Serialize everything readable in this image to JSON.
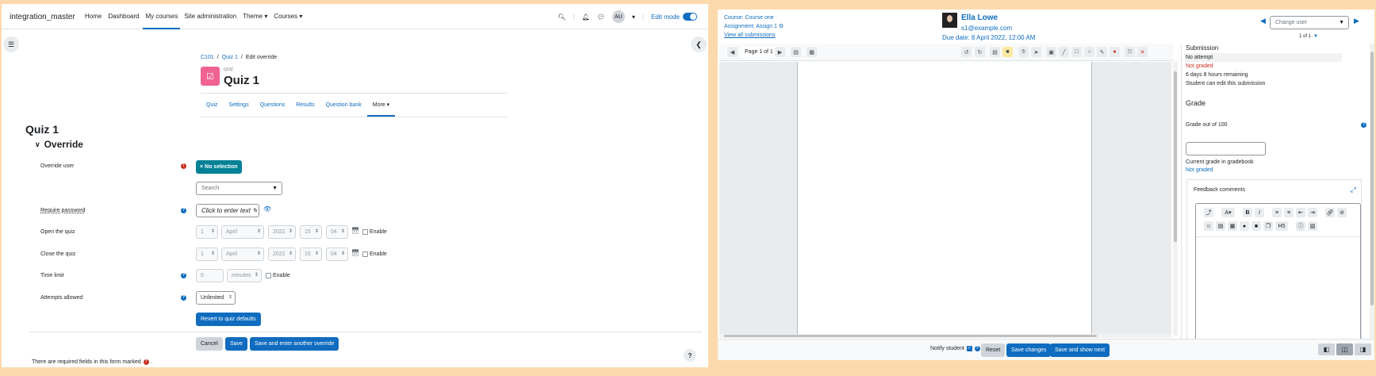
{
  "left": {
    "brand": "integration_master",
    "nav": [
      "Home",
      "Dashboard",
      "My courses",
      "Site administration",
      "Theme ▾",
      "Courses ▾"
    ],
    "avatar": "AU",
    "edit_mode": "Edit mode",
    "breadcrumb": [
      "C101",
      "Quiz 1",
      "Edit override"
    ],
    "module_kind": "QUIZ",
    "module_title": "Quiz 1",
    "tabs": [
      "Quiz",
      "Settings",
      "Questions",
      "Results",
      "Question bank",
      "More ▾"
    ],
    "heading": "Quiz 1",
    "section": "Override",
    "fields": {
      "override_user": "Override user",
      "no_selection": "× No selection",
      "search_placeholder": "Search",
      "require_password": "Require password",
      "password_value": "Click to enter text ✎",
      "open_quiz": "Open the quiz",
      "close_quiz": "Close the quiz",
      "time_limit": "Time limit",
      "attempts_allowed": "Attempts allowed",
      "enable": "Enable",
      "day": "1",
      "month": "April",
      "year": "2022",
      "hour": "15",
      "minute": "04",
      "time_value": "0",
      "time_unit": "minutes",
      "attempts_value": "Unlimited"
    },
    "buttons": {
      "revert": "Revert to quiz defaults",
      "cancel": "Cancel",
      "save": "Save",
      "save_another": "Save and enter another override"
    },
    "required_note": "There are required fields in this form marked",
    "required_note_end": "."
  },
  "right": {
    "course_link": "Course: Course one",
    "assignment_link": "Assignment: Assign 1",
    "view_all": "View all submissions",
    "user_name": "Ella Lowe",
    "user_email": "s1@example.com",
    "due_date": "Due date: 8 April 2022, 12:00 AM",
    "change_user": "Change user",
    "of_count": "1 of 1",
    "page_label": "Page 1 of 1",
    "submission": {
      "heading": "Submission",
      "attempt": "No attempt",
      "graded": "Not graded",
      "remaining": "6 days 8 hours remaining",
      "editable": "Student can edit this submission"
    },
    "grade": {
      "heading": "Grade",
      "grade_out_of": "Grade out of 100",
      "current_grade": "Current grade in gradebook",
      "current_value": "Not graded"
    },
    "feedback_heading": "Feedback comments",
    "footer": {
      "notify": "Notify student",
      "reset": "Reset",
      "save": "Save changes",
      "save_next": "Save and show next"
    }
  },
  "colors": {
    "primary": "#0f6cbf",
    "danger": "#ca3120",
    "background": "#fcd9ad",
    "quiz_icon": "#f06292"
  }
}
